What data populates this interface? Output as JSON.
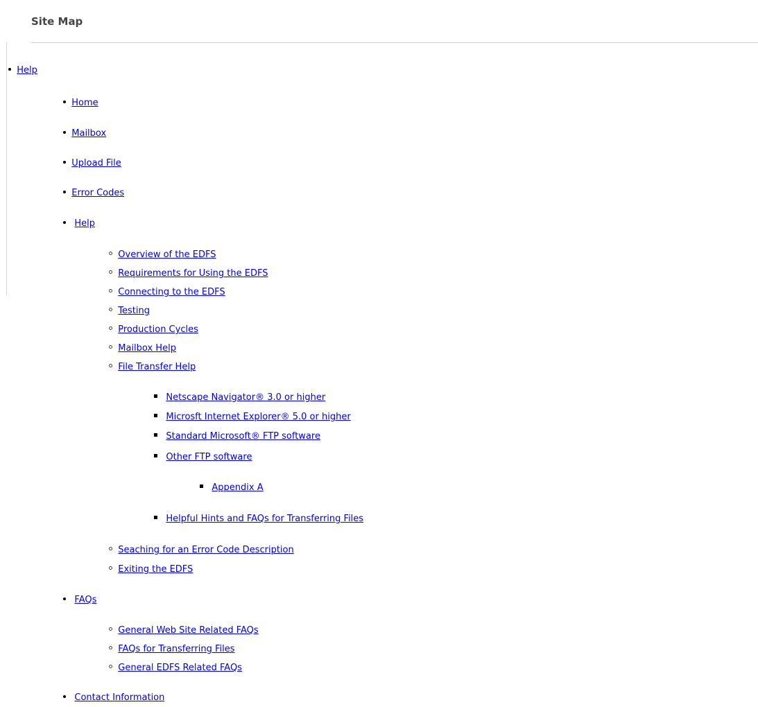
{
  "page": {
    "title": "Site Map"
  },
  "sitemap": {
    "help": "Help",
    "home": "Home",
    "mailbox": "Mailbox",
    "upload_file": "Upload File",
    "error_codes": "Error Codes",
    "help_section": {
      "label": "Help",
      "items": {
        "overview": "Overview of the EDFS",
        "requirements": "Requirements for Using the EDFS",
        "connecting": "Connecting to the EDFS",
        "testing": "Testing",
        "production_cycles": "Production Cycles",
        "mailbox_help": "Mailbox Help",
        "file_transfer_help": "File Transfer Help",
        "file_transfer": {
          "netscape": "Netscape Navigator® 3.0 or higher",
          "ie": "Microsft Internet Explorer® 5.0 or higher",
          "standard_ftp": "Standard Microsoft® FTP software",
          "other_ftp": "Other FTP software",
          "appendix_a": "Appendix A",
          "helpful_hints": "Helpful Hints and FAQs for Transferring Files"
        },
        "searching_error": "Seaching for an Error Code Description",
        "exiting": "Exiting the EDFS"
      }
    },
    "faqs_section": {
      "label": "FAQs",
      "items": {
        "general_web": "General Web Site Related FAQs",
        "transferring": "FAQs for Transferring Files",
        "general_edfs": "General EDFS Related FAQs"
      }
    },
    "contact": "Contact Information"
  },
  "colors": {
    "link": "#0000ee",
    "title": "#444444",
    "rule": "#cfcfcf"
  }
}
